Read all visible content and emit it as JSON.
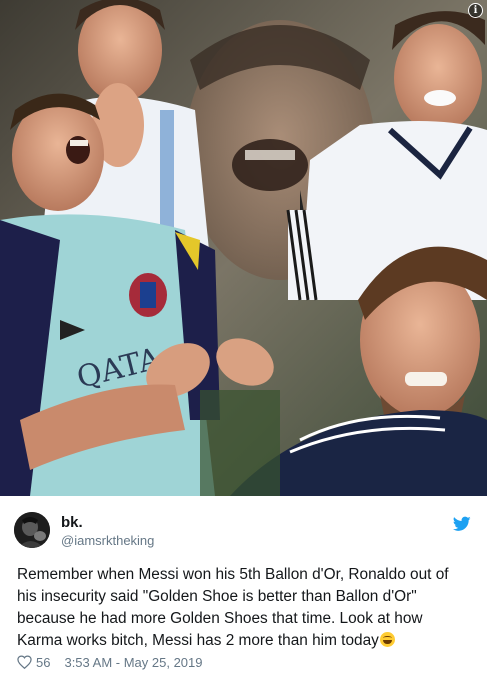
{
  "tweet": {
    "author": {
      "display_name": "bk.",
      "handle": "@iamsrktheking"
    },
    "text_lines": [
      "Remember when Messi won his 5th Ballon d'Or, Ronaldo out of",
      "his insecurity said \"Golden Shoe is better than Ballon d'Or\"",
      "because he had more Golden Shoes that time. Look at how",
      "Karma works bitch, Messi has 2 more than him today"
    ],
    "emoji": "grinning-squinting-face",
    "likes": "56",
    "timestamp": "3:53 AM - May 25, 2019",
    "media": {
      "description_icon": "i",
      "jersey_text": "QATA"
    }
  },
  "colors": {
    "name_text": "#14171a",
    "secondary_text": "#657786",
    "twitter_blue": "#1da1f2"
  },
  "icons": [
    "info-icon",
    "twitter-bird-icon",
    "heart-icon",
    "avatar-image"
  ]
}
